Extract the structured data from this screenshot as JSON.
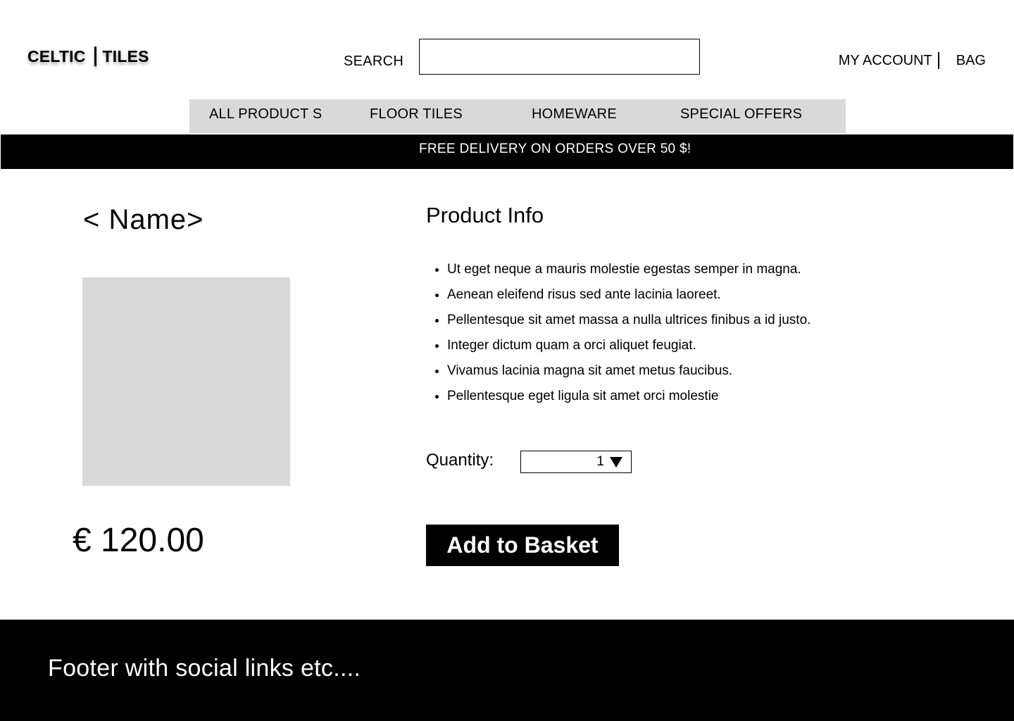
{
  "header": {
    "logo_left": "CELTIC",
    "logo_right": "TILES",
    "search_label": "SEARCH",
    "search_value": "",
    "account_label": "MY ACCOUNT",
    "bag_label": "BAG"
  },
  "nav": {
    "items": [
      {
        "label": "ALL  PRODUCT S"
      },
      {
        "label": "FLOOR TILES"
      },
      {
        "label": "HOMEWARE"
      },
      {
        "label": "SPECIAL OFFERS"
      }
    ]
  },
  "banner": {
    "text": "FREE DELIVERY ON ORDERS OVER  50 $!"
  },
  "product": {
    "name": "< Name>",
    "price": "€ 120.00",
    "info_title": "Product Info",
    "bullets": [
      "Ut eget neque a mauris molestie egestas semper in magna.",
      "Aenean eleifend risus sed ante lacinia laoreet.",
      "Pellentesque sit amet massa a nulla ultrices finibus a id justo.",
      "Integer dictum quam a orci aliquet feugiat.",
      "Vivamus lacinia magna sit amet metus faucibus.",
      "Pellentesque eget ligula sit amet orci molestie"
    ],
    "quantity_label": "Quantity:",
    "quantity_value": "1",
    "add_button": "Add to Basket"
  },
  "footer": {
    "text": "Footer with social links etc...."
  },
  "colors": {
    "placeholder_gray": "#d9d9d9",
    "banner_bg": "#000000",
    "banner_text": "#ffffff"
  }
}
